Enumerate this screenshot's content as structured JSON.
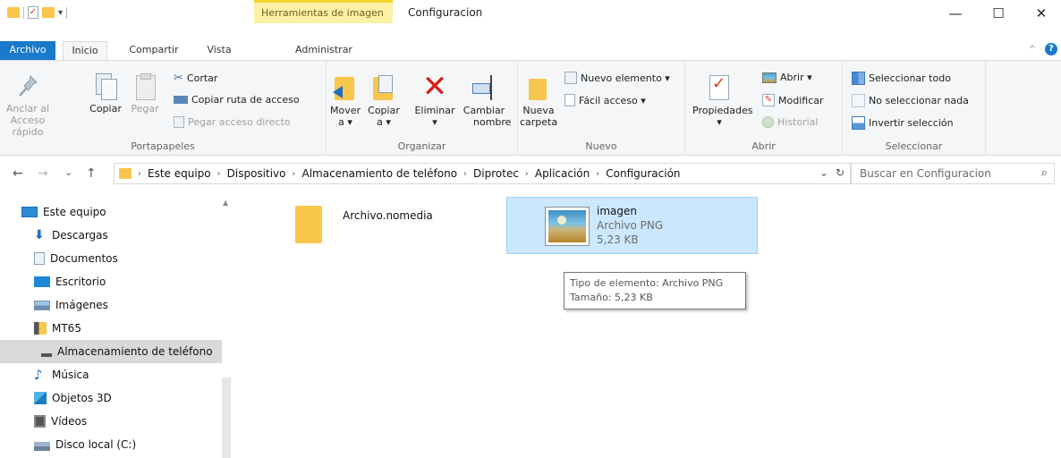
{
  "titlebar": {
    "context_tab_title": "Herramientas de imagen",
    "window_title": "Configuracion",
    "minimize": "—",
    "maximize": "☐",
    "close": "✕"
  },
  "tabs": {
    "file": "Archivo",
    "home": "Inicio",
    "share": "Compartir",
    "view": "Vista",
    "manage": "Administrar",
    "collapse": "^",
    "help": "?"
  },
  "ribbon": {
    "clipboard": {
      "pin_line1": "Anclar al",
      "pin_line2": "Acceso rápido",
      "copy": "Copiar",
      "paste": "Pegar",
      "cut": "Cortar",
      "copy_path": "Copiar ruta de acceso",
      "paste_shortcut": "Pegar acceso directo",
      "label": "Portapapeles"
    },
    "organize": {
      "move_line1": "Mover",
      "move_line2": "a ▾",
      "copy_line1": "Copiar",
      "copy_line2": "a ▾",
      "delete_line1": "Eliminar",
      "delete_line2": "▾",
      "rename_line1": "Cambiar",
      "rename_line2": "nombre",
      "label": "Organizar"
    },
    "new": {
      "folder_line1": "Nueva",
      "folder_line2": "carpeta",
      "new_item": "Nuevo elemento ▾",
      "easy_access": "Fácil acceso ▾",
      "label": "Nuevo"
    },
    "open": {
      "properties": "Propiedades",
      "properties_arrow": "▾",
      "open": "Abrir ▾",
      "edit": "Modificar",
      "history": "Historial",
      "label": "Abrir"
    },
    "select": {
      "select_all": "Seleccionar todo",
      "select_none": "No seleccionar nada",
      "invert": "Invertir selección",
      "label": "Seleccionar"
    }
  },
  "address": {
    "back": "←",
    "forward": "→",
    "recent": "⌄",
    "up": "↑",
    "crumbs": [
      "Este equipo",
      "Dispositivo",
      "Almacenamiento de teléfono",
      "Diprotec",
      "Aplicación",
      "Configuración"
    ],
    "dropdown": "⌄",
    "refresh": "↻",
    "search_placeholder": "Buscar en Configuracion",
    "search_icon": "⌕"
  },
  "navpane": {
    "items": [
      {
        "label": "Este equipo",
        "icon": "computer-icon"
      },
      {
        "label": "Descargas",
        "icon": "downloads-icon"
      },
      {
        "label": "Documentos",
        "icon": "documents-icon"
      },
      {
        "label": "Escritorio",
        "icon": "desktop-icon"
      },
      {
        "label": "Imágenes",
        "icon": "pictures-icon"
      },
      {
        "label": "MT65",
        "icon": "phone-icon"
      },
      {
        "label": "Almacenamiento de teléfono",
        "icon": "storage-icon"
      },
      {
        "label": "Música",
        "icon": "music-icon"
      },
      {
        "label": "Objetos 3D",
        "icon": "objects3d-icon"
      },
      {
        "label": "Vídeos",
        "icon": "videos-icon"
      },
      {
        "label": "Disco local (C:)",
        "icon": "drive-icon"
      }
    ],
    "scroll_up": "▲"
  },
  "content": {
    "folder": {
      "name": "Archivo.nomedia"
    },
    "file": {
      "name": "imagen",
      "type": "Archivo PNG",
      "size": "5,23 KB"
    },
    "tooltip": {
      "line1": "Tipo de elemento: Archivo PNG",
      "line2": "Tamaño: 5,23 KB"
    }
  },
  "colors": {
    "accent": "#1979ca",
    "selection": "#cce8ff",
    "selection_border": "#99d1ff",
    "context_tab": "#fcf1a5",
    "folder": "#f7c64b",
    "delete_red": "#d6201c"
  }
}
